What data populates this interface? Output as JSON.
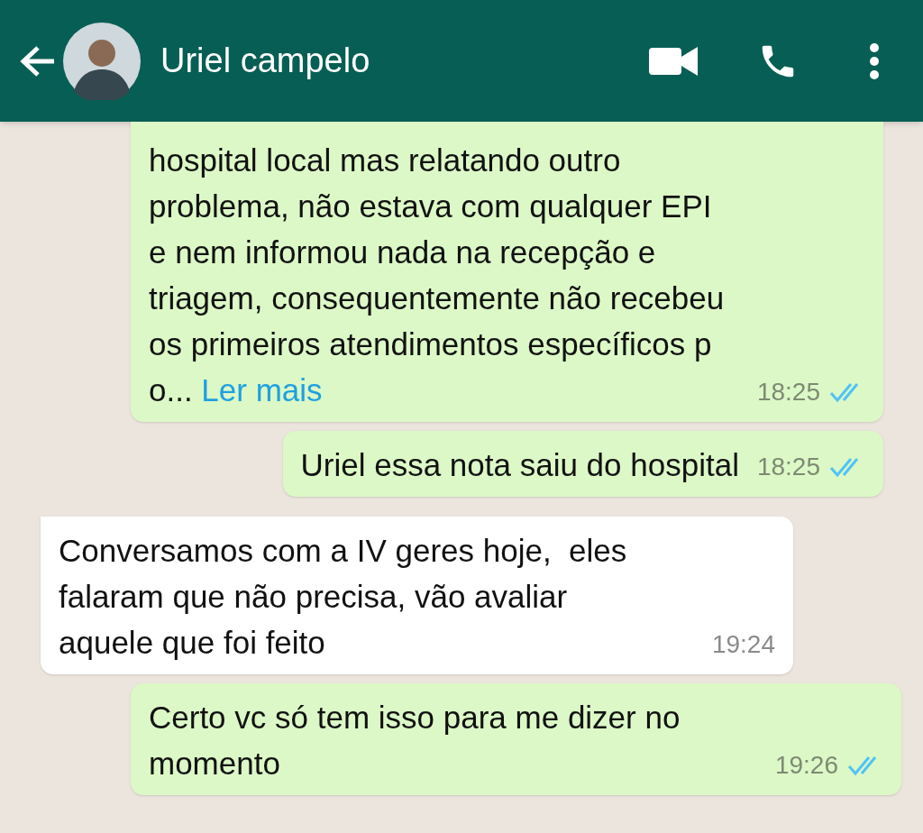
{
  "header": {
    "contact_name": "Uriel campelo"
  },
  "messages": [
    {
      "kind": "outgoing",
      "text": "hospital local mas relatando outro\nproblema, não estava com qualquer EPI\ne nem informou nada na recepção e\ntriagem, consequentemente não recebeu\nos primeiros atendimentos específicos p\no...",
      "more_link": "Ler mais",
      "time": "18:25",
      "read": true,
      "cut_top": true
    },
    {
      "kind": "outgoing",
      "text": "Uriel essa nota saiu do hospital",
      "time": "18:25",
      "read": true
    },
    {
      "kind": "incoming",
      "text": "Conversamos com a IV geres hoje,  eles\nfalaram que não precisa, vão avaliar\naquele que foi feito",
      "time": "19:24"
    },
    {
      "kind": "outgoing",
      "text": "Certo vc só tem isso para me dizer no\nmomento",
      "time": "19:26",
      "read": true
    }
  ]
}
